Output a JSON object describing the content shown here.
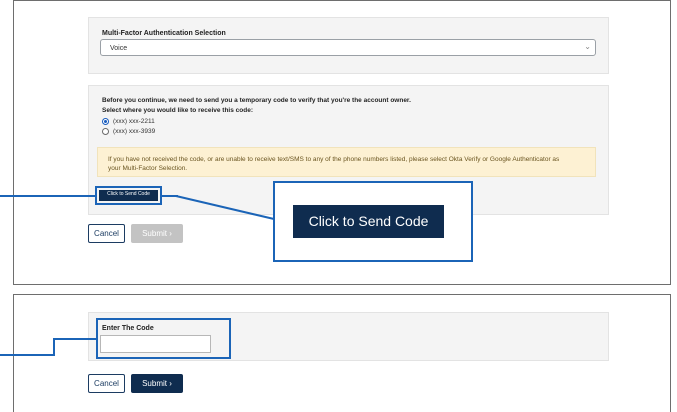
{
  "mfa": {
    "label": "Multi-Factor Authentication Selection",
    "selected": "Voice",
    "chevron": "⌄"
  },
  "code_request": {
    "intro": "Before you continue, we need to send you a temporary code to verify that you're the account owner.",
    "select_label": "Select where you would like to receive this code:",
    "options": [
      {
        "label": "(xxx) xxx-2211",
        "checked": true
      },
      {
        "label": "(xxx) xxx-3939",
        "checked": false
      }
    ],
    "notice_line1": "If you have not received the code, or are unable to receive text/SMS to any of the phone numbers listed, please select Okta Verify or Google Authenticator as",
    "notice_line2": "your Multi-Factor Selection.",
    "send_button": "Click to Send Code"
  },
  "callout": {
    "button_label": "Click to Send Code"
  },
  "actions_top": {
    "cancel": "Cancel",
    "submit": "Submit ›"
  },
  "enter_code": {
    "label": "Enter The Code",
    "value": ""
  },
  "actions_bottom": {
    "cancel": "Cancel",
    "submit": "Submit ›"
  },
  "colors": {
    "highlight": "#1b64b7",
    "primary_button": "#0f2c4f",
    "disabled_button": "#c3c3c3",
    "notice_bg": "#fdf1d3"
  }
}
